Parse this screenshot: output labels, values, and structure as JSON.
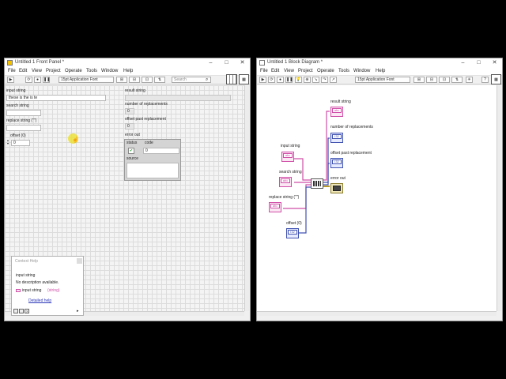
{
  "front_panel": {
    "title": "Untitled 1 Front Panel *",
    "menu": [
      "File",
      "Edit",
      "View",
      "Project",
      "Operate",
      "Tools",
      "Window",
      "Help"
    ],
    "font_label": "15pt Application Font",
    "search_placeholder": "Search",
    "controls": {
      "input_string_label": "input string",
      "input_string_value": "these is the is te",
      "search_string_label": "search string",
      "replace_string_label": "replace string (\"\")",
      "offset_label": "offset (0)",
      "offset_value": "0"
    },
    "indicators": {
      "result_string_label": "result string",
      "number_of_replacements_label": "number of replacements",
      "number_of_replacements_value": "0",
      "offset_past_replacement_label": "offset past replacement",
      "offset_past_replacement_value": "0",
      "error_out_label": "error out",
      "status_label": "status",
      "code_label": "code",
      "code_value": "0",
      "source_label": "source"
    },
    "context_help": {
      "title": "Context Help",
      "heading": "input string",
      "description": "No description available.",
      "type_name": "input string",
      "type_detail": "(string)",
      "link": "Detailed help"
    }
  },
  "block_diagram": {
    "title": "Untitled 1 Block Diagram *",
    "menu": [
      "File",
      "Edit",
      "View",
      "Project",
      "Operate",
      "Tools",
      "Window",
      "Help"
    ],
    "font_label": "15pt Application Font",
    "terminals": {
      "input_string": "input string",
      "search_string": "search string",
      "replace_string": "replace string (\"\")",
      "offset": "offset (0)",
      "result_string": "result string",
      "number_of_replacements": "number of replacements",
      "offset_past_replacement": "offset past replacement",
      "error_out": "error out",
      "abc": "abc",
      "i32": "I32"
    }
  },
  "colors": {
    "string_wire": "#d04fa8",
    "numeric_wire": "#4052b0",
    "error_wire": "#b59a2a"
  }
}
